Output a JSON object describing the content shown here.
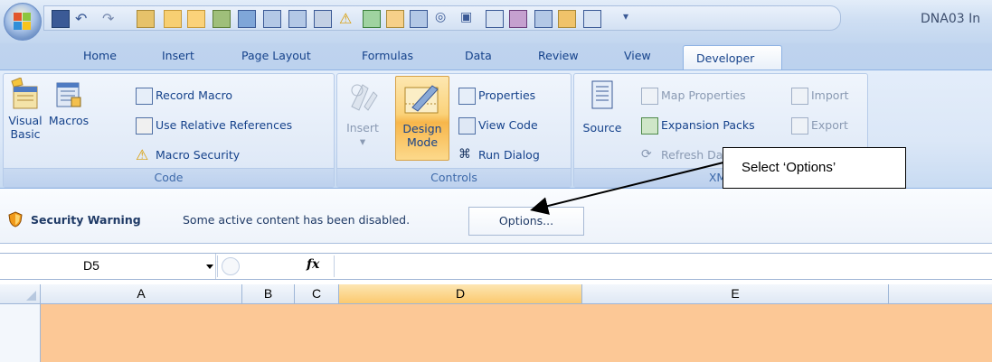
{
  "window": {
    "title": "DNA03 In"
  },
  "tabs": [
    "Home",
    "Insert",
    "Page Layout",
    "Formulas",
    "Data",
    "Review",
    "View",
    "Developer"
  ],
  "active_tab": "Developer",
  "ribbon": {
    "code": {
      "label": "Code",
      "visual_basic": "Visual Basic",
      "macros": "Macros",
      "record_macro": "Record Macro",
      "use_relative": "Use Relative References",
      "macro_security": "Macro Security"
    },
    "controls": {
      "label": "Controls",
      "insert": "Insert",
      "design_mode": "Design Mode",
      "properties": "Properties",
      "view_code": "View Code",
      "run_dialog": "Run Dialog"
    },
    "xml": {
      "label": "XML",
      "source": "Source",
      "map_properties": "Map Properties",
      "expansion_packs": "Expansion Packs",
      "refresh_data": "Refresh Data",
      "import": "Import",
      "export": "Export"
    }
  },
  "message_bar": {
    "title": "Security Warning",
    "text": "Some active content has been disabled.",
    "button": "Options..."
  },
  "formula_bar": {
    "name_box": "D5",
    "fx": "fx"
  },
  "sheet": {
    "columns": [
      "A",
      "B",
      "C",
      "D",
      "E"
    ],
    "selected_column": "D"
  },
  "callout": {
    "text": "Select ‘Options’"
  },
  "colors": {
    "ribbon_bg": "#dbe7f7",
    "selected_header": "#fbc96e",
    "selected_row": "#fcc896",
    "tab_text": "#15428b"
  }
}
